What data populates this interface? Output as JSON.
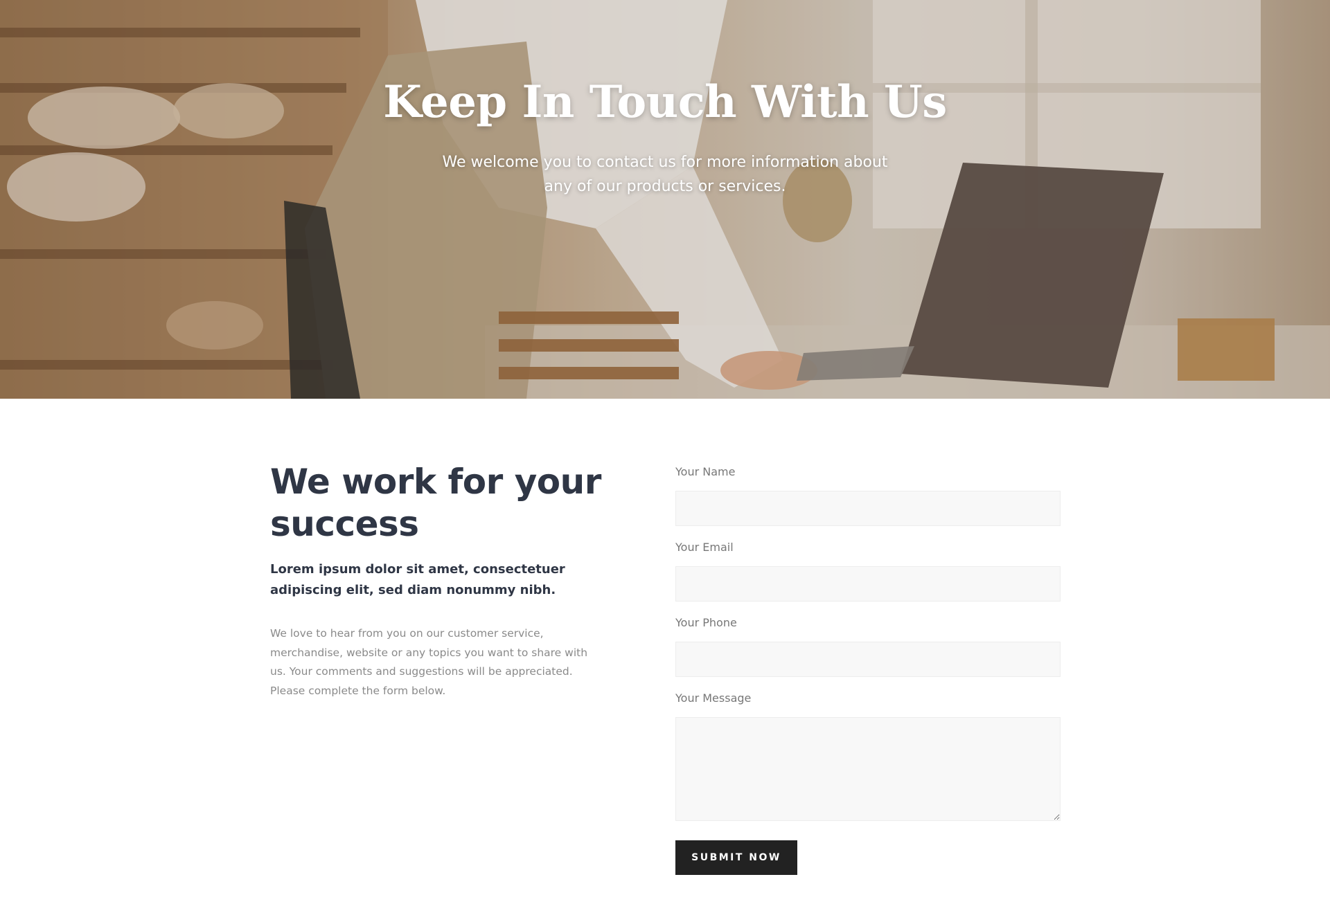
{
  "hero": {
    "title": "Keep In Touch With Us",
    "subtitle": "We welcome you to contact us for more information about any of our products or services."
  },
  "intro": {
    "headline": "We work for your success",
    "lead": "Lorem ipsum dolor sit amet, consectetuer adipiscing elit, sed diam nonummy nibh.",
    "body": "We love to hear from you on our customer service, merchandise, website or any topics you want to share with us. Your comments and suggestions will be appreciated. Please complete the form below."
  },
  "form": {
    "name_label": "Your Name",
    "name_value": "",
    "email_label": "Your Email",
    "email_value": "",
    "phone_label": "Your Phone",
    "phone_value": "",
    "message_label": "Your Message",
    "message_value": "",
    "submit_label": "SUBMIT NOW"
  },
  "colors": {
    "heading": "#2f3645",
    "muted_text": "#8a8a8a",
    "field_bg": "#f8f8f8",
    "button_bg": "#222222",
    "button_text": "#ffffff"
  }
}
